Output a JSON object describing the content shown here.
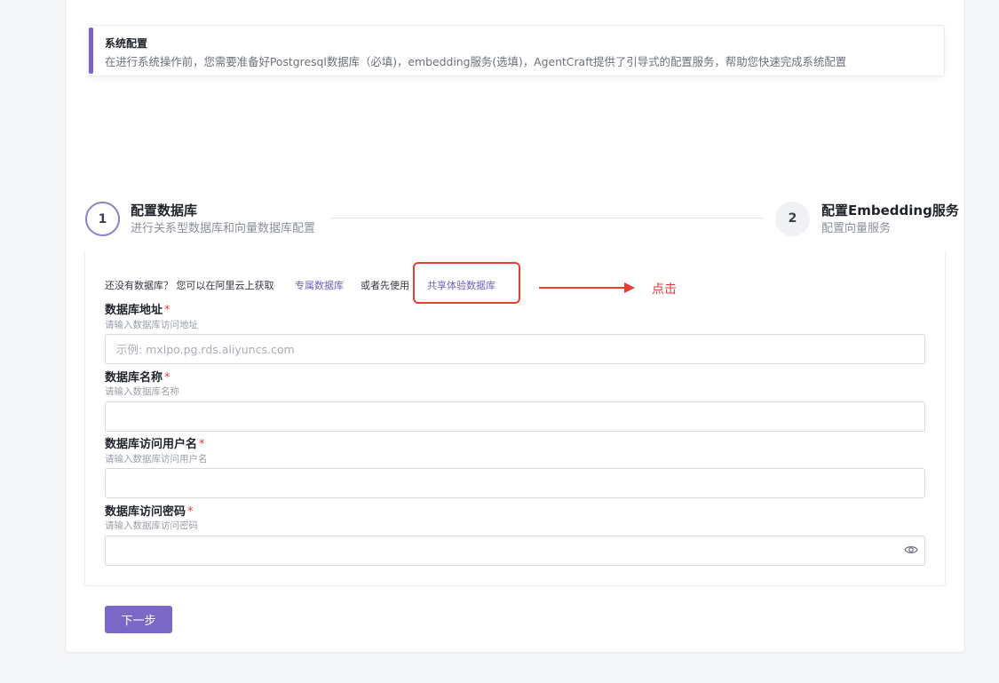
{
  "notice": {
    "title": "系统配置",
    "text": "在进行系统操作前，您需要准备好Postgresql数据库（必填)，embedding服务(选填)，AgentCraft提供了引导式的配置服务，帮助您快速完成系统配置"
  },
  "steps": [
    {
      "number": "1",
      "title": "配置数据库",
      "subtitle": "进行关系型数据库和向量数据库配置"
    },
    {
      "number": "2",
      "title": "配置Embedding服务",
      "subtitle": "配置向量服务"
    }
  ],
  "hint": {
    "prefix": "还没有数据库？ 您可以在阿里云上获取",
    "dedicated_link": "专属数据库",
    "middle": "或者先使用",
    "shared_link": "共享体验数据库"
  },
  "annotation": {
    "text": "点击",
    "color": "#e53e36"
  },
  "fields": [
    {
      "label": "数据库地址",
      "required": "*",
      "help": "请输入数据库访问地址",
      "value": "",
      "placeholder": "示例: mxlpo.pg.rds.aliyuncs.com"
    },
    {
      "label": "数据库名称",
      "required": "*",
      "help": "请输入数据库名称",
      "value": "",
      "placeholder": ""
    },
    {
      "label": "数据库访问用户名",
      "required": "*",
      "help": "请输入数据库访问用户名",
      "value": "",
      "placeholder": ""
    },
    {
      "label": "数据库访问密码",
      "required": "*",
      "help": "请输入数据库访问密码",
      "value": "",
      "placeholder": ""
    }
  ],
  "next_button": "下一步",
  "colors": {
    "accent": "#7b68c6",
    "link": "#6d5fc2",
    "annotation": "#e53e36"
  },
  "icons": {
    "password_toggle": "eye-icon"
  }
}
